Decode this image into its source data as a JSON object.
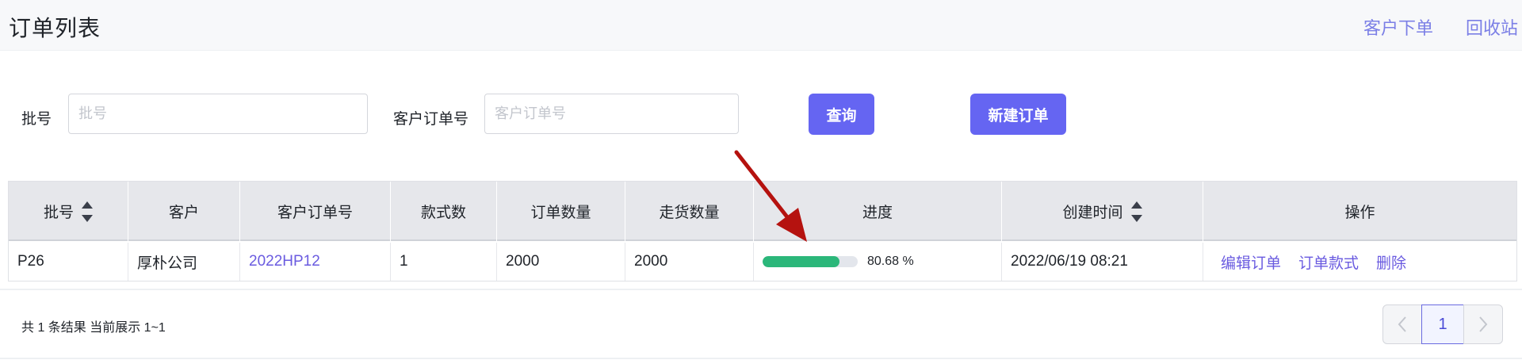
{
  "header": {
    "title": "订单列表",
    "links": [
      "客户下单",
      "回收站"
    ]
  },
  "filters": {
    "batch_label": "批号",
    "batch_placeholder": "批号",
    "batch_value": "",
    "customer_order_label": "客户订单号",
    "customer_order_placeholder": "客户订单号",
    "customer_order_value": "",
    "query_button": "查询",
    "new_order_button": "新建订单"
  },
  "table": {
    "columns": [
      "批号",
      "客户",
      "客户订单号",
      "款式数",
      "订单数量",
      "走货数量",
      "进度",
      "创建时间",
      "操作"
    ],
    "sortable_columns": [
      "批号",
      "创建时间"
    ],
    "rows": [
      {
        "batch": "P26",
        "customer": "厚朴公司",
        "customer_order_no": "2022HP12",
        "styles": "1",
        "order_qty": "2000",
        "shipped_qty": "2000",
        "progress_text": "80.68 %",
        "progress_value": 0.8068,
        "created": "2022/06/19 08:21",
        "actions": [
          "编辑订单",
          "订单款式",
          "删除"
        ]
      }
    ]
  },
  "footer": {
    "summary": "共 1 条结果 当前展示 1~1",
    "pager": {
      "prev_icon": "chevron-left-icon",
      "current_page": "1",
      "next_icon": "chevron-right-icon"
    }
  },
  "colors": {
    "accent": "#6565f2",
    "link": "#6a5be0",
    "progress": "#2bb77a",
    "annotation_arrow": "#b5120f"
  }
}
